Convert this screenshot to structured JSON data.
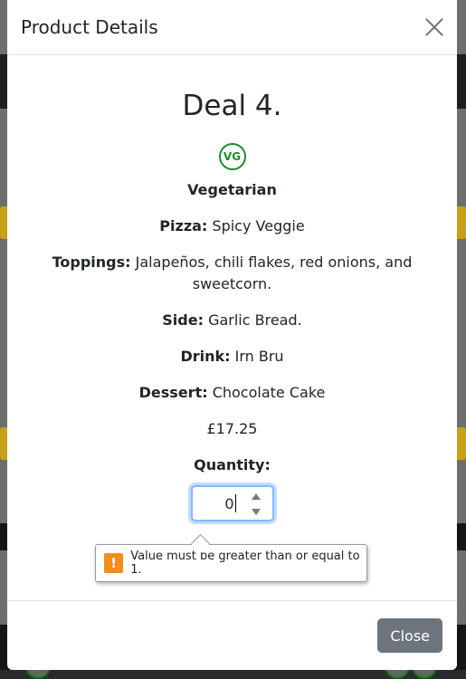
{
  "modal": {
    "title": "Product Details",
    "deal_name": "Deal 4.",
    "badge": "VG",
    "category": "Vegetarian",
    "details": [
      {
        "label": "Pizza:",
        "value": "Spicy Veggie"
      },
      {
        "label": "Toppings:",
        "value": "Jalapeños, chili flakes, red onions, and sweetcorn."
      },
      {
        "label": "Side:",
        "value": "Garlic Bread."
      },
      {
        "label": "Drink:",
        "value": "Irn Bru"
      },
      {
        "label": "Dessert:",
        "value": "Chocolate Cake"
      }
    ],
    "price": "£17.25",
    "quantity_label": "Quantity:",
    "quantity_value": "0",
    "validation_message": "Value must be greater than or equal to 1.",
    "close_label": "Close"
  },
  "colors": {
    "vegetarian_green": "#1c8c2b",
    "close_button": "#6c757d",
    "warning": "#f28c1b",
    "focus_border": "#86b7fe"
  }
}
